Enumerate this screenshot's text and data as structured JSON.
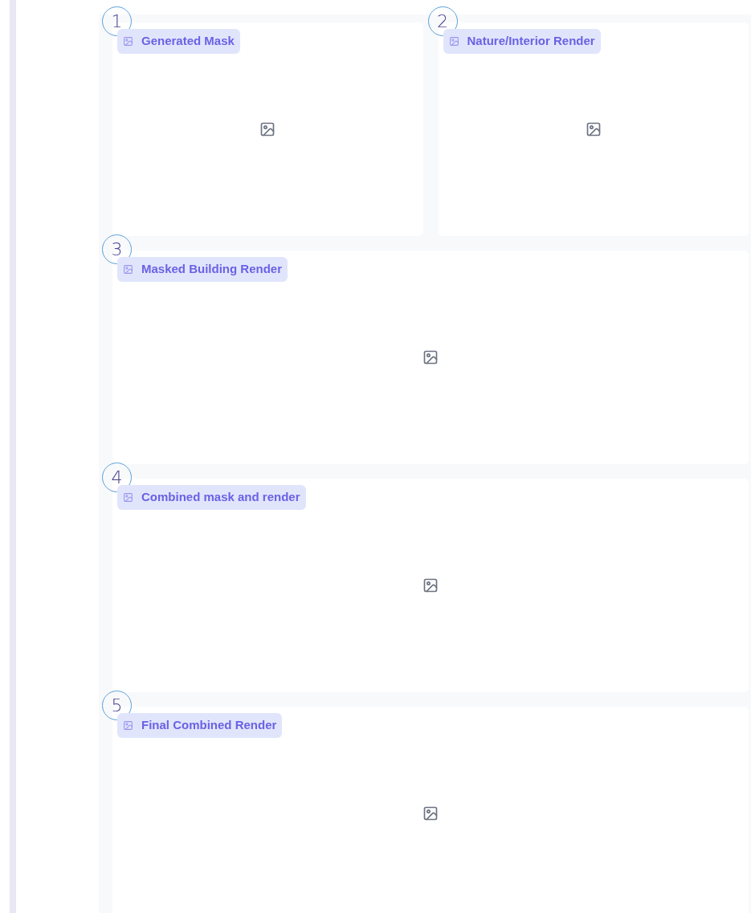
{
  "rows": [
    {
      "panels": [
        {
          "number": "1",
          "title": "Generated Mask"
        },
        {
          "number": "2",
          "title": "Nature/Interior Render"
        }
      ]
    },
    {
      "panels": [
        {
          "number": "3",
          "title": "Masked Building Render"
        }
      ]
    },
    {
      "panels": [
        {
          "number": "4",
          "title": "Combined mask and render"
        }
      ]
    },
    {
      "panels": [
        {
          "number": "5",
          "title": "Final Combined Render"
        }
      ]
    }
  ]
}
